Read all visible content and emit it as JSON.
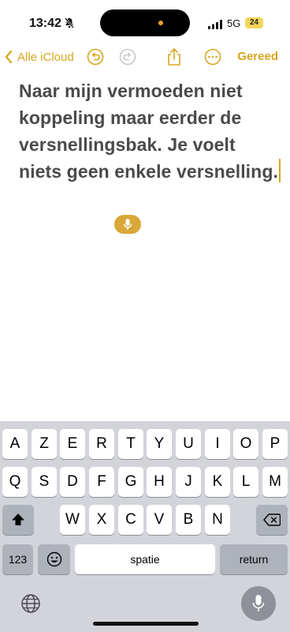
{
  "status": {
    "time": "13:42",
    "network": "5G",
    "battery": "24"
  },
  "toolbar": {
    "back_label": "Alle iCloud",
    "done_label": "Gereed"
  },
  "note": {
    "text": "Naar mijn vermoeden niet koppeling maar eerder de versnellingsbak. Je voelt niets geen enkele versnelling."
  },
  "keyboard": {
    "row1": [
      "A",
      "Z",
      "E",
      "R",
      "T",
      "Y",
      "U",
      "I",
      "O",
      "P"
    ],
    "row2": [
      "Q",
      "S",
      "D",
      "F",
      "G",
      "H",
      "J",
      "K",
      "L",
      "M"
    ],
    "row3": [
      "W",
      "X",
      "C",
      "V",
      "B",
      "N"
    ],
    "numbers_label": "123",
    "space_label": "spatie",
    "return_label": "return"
  },
  "colors": {
    "accent": "#d8a520",
    "keyboard_bg": "#d2d4da"
  }
}
